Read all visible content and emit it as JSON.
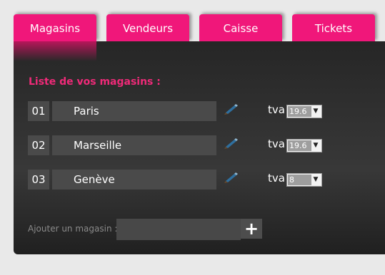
{
  "tabs": [
    {
      "label": "Magasins",
      "active": true
    },
    {
      "label": "Vendeurs",
      "active": false
    },
    {
      "label": "Caisse",
      "active": false
    },
    {
      "label": "Tickets",
      "active": false
    }
  ],
  "section_title": "Liste de vos magasins :",
  "stores": [
    {
      "number": "01",
      "name": "Paris",
      "tva_label": "tva",
      "tva_value": "19.6"
    },
    {
      "number": "02",
      "name": "Marseille",
      "tva_label": "tva",
      "tva_value": "19.6"
    },
    {
      "number": "03",
      "name": "Genève",
      "tva_label": "tva",
      "tva_value": "8"
    }
  ],
  "add_store": {
    "label": "Ajouter un magasin :",
    "input_value": "",
    "button_label": "+"
  },
  "colors": {
    "accent": "#f0177a",
    "title": "#ef2a78",
    "panel": "#2e2e2e",
    "field": "#4a4a4a"
  },
  "icons": {
    "edit": "pen-icon",
    "dropdown": "chevron-down-icon"
  }
}
